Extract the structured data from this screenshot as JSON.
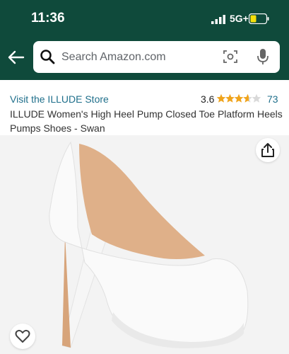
{
  "status_bar": {
    "time": "11:36",
    "network": "5G+",
    "battery_color": "#f5e00a"
  },
  "search": {
    "placeholder": "Search Amazon.com"
  },
  "product": {
    "store_link": "Visit the ILLUDE Store",
    "rating": "3.6",
    "rating_stars_value": 3.6,
    "review_count": "73",
    "title": "ILLUDE Women's High Heel Pump Closed Toe Platform Heels Pumps Shoes - Swan"
  },
  "icons": {
    "back": "back-arrow-icon",
    "search": "search-icon",
    "camera": "camera-scan-icon",
    "mic": "microphone-icon",
    "share": "share-icon",
    "favorite": "heart-icon"
  },
  "colors": {
    "header_bg": "#0f4a3b",
    "link": "#1f6f8b",
    "star": "#f0a41c"
  }
}
